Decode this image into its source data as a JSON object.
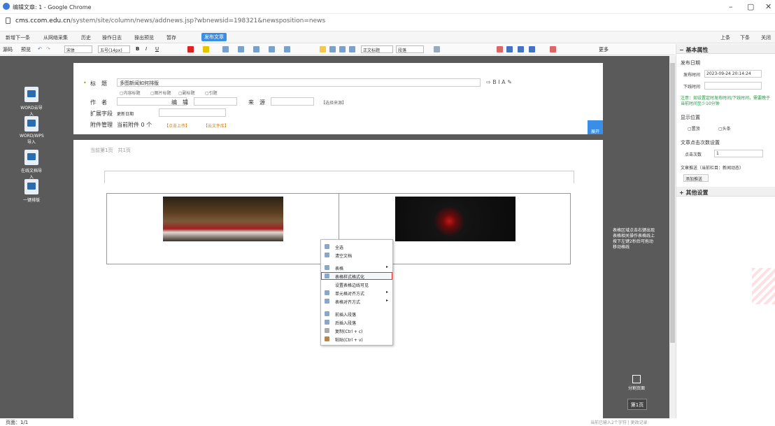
{
  "window": {
    "title": "编辑文章: 1 - Google Chrome",
    "url_host": "cms.ccom.edu.cn",
    "url_path": "/system/site/column/news/addnews.jsp?wbnewsid=198321&newsposition=news"
  },
  "toolbar1": {
    "items": [
      "新增下一条",
      "从网络采集",
      "历史",
      "操作日志",
      "操出预览",
      "暂存"
    ],
    "publish": "发布文章",
    "right": [
      "上条",
      "下条",
      "关闭"
    ]
  },
  "toolbar2": {
    "source": "源码",
    "preview": "预览",
    "font": "宋体",
    "size": "五号(14px)",
    "style": "正文标题",
    "para": "段落",
    "more": "更多"
  },
  "left_tools": [
    "WORD云导入",
    "WORD/WPS导入",
    "在线文档导入",
    "一键排版"
  ],
  "form": {
    "title_label": "标　题",
    "title_value": "多图新闻如何排版",
    "title_checks": [
      "内容标题",
      "图片标题",
      "副标题",
      "引题"
    ],
    "author_label": "作　者",
    "editor_label": "编　辑",
    "source_label": "来　源",
    "source_link": "【选择来源】",
    "ext_label": "扩展字段",
    "ext_field": "更新日期",
    "attach_label": "附件管理",
    "attach_count": "当前附件 0 个",
    "attach_upload": "【点击上传】",
    "attach_cloud": "【云文件库】",
    "expand": "展开"
  },
  "page": {
    "info": "当前第1页　共1页",
    "hint": "表格区域点击右键出现表格相关操作表格线上按下左键2秒后可拖动移动格线",
    "split_label": "分割页面",
    "page_btn": "第1页"
  },
  "context_menu": {
    "items": [
      {
        "label": "全选",
        "arrow": ""
      },
      {
        "label": "清空文档",
        "arrow": ""
      },
      {
        "label": "表格",
        "arrow": "▸"
      },
      {
        "label": "表格样式格式化",
        "arrow": "",
        "highlight": true
      },
      {
        "label": "设置表格边线可见",
        "arrow": ""
      },
      {
        "label": "单元格对齐方式",
        "arrow": "▸"
      },
      {
        "label": "表格对齐方式",
        "arrow": "▸"
      },
      {
        "label": "前插入段落",
        "arrow": ""
      },
      {
        "label": "后插入段落",
        "arrow": ""
      },
      {
        "label": "复制(Ctrl + c)",
        "arrow": ""
      },
      {
        "label": "粘贴(Ctrl + v)",
        "arrow": ""
      }
    ]
  },
  "right_panel": {
    "basic_header": "− 基本属性",
    "publish_date": "发布日期",
    "publish_time_label": "发布时间",
    "publish_time_value": "2023-09-24 20:14:24",
    "offline_time_label": "下线时间",
    "note": "注意：如设置定时发布时间/下线时间，需要晚于当前时间至少10分钟",
    "display_pos": "显示位置",
    "opt_top": "置顶",
    "opt_headline": "头条",
    "click_settings": "文章点击次数设置",
    "click_label": "点击次数",
    "click_value": "1",
    "push_label": "文章推送（当前栏目：新闻动态）",
    "push_btn": "添加推送",
    "other_header": "+ 其他设置"
  },
  "status": {
    "page": "页面：1/1",
    "right": "当前已输入2个字符 | 更改记录"
  }
}
